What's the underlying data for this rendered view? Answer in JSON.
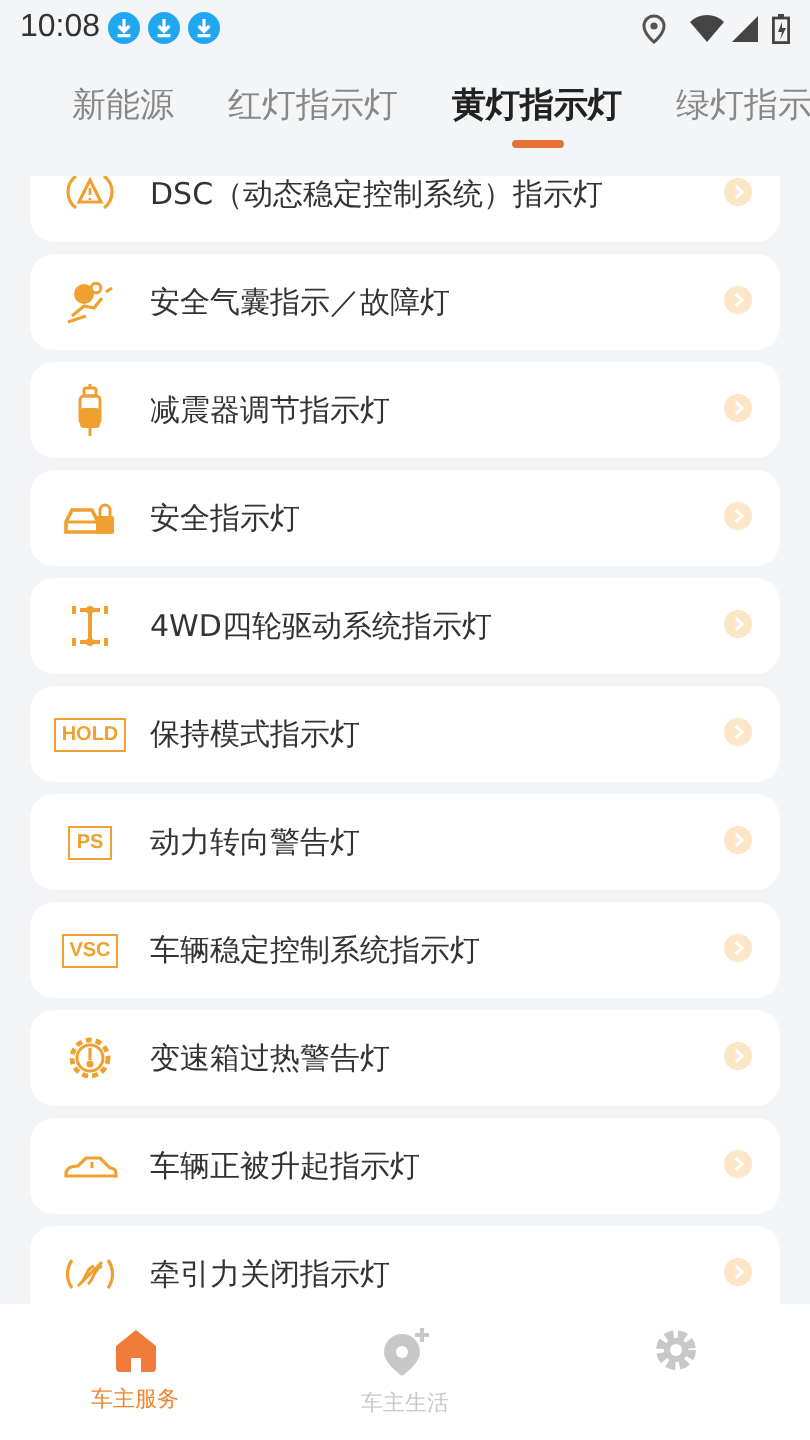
{
  "status_bar": {
    "time": "10:08"
  },
  "tabs": [
    {
      "label": "新能源",
      "selected": false
    },
    {
      "label": "红灯指示灯",
      "selected": false
    },
    {
      "label": "黄灯指示灯",
      "selected": true
    },
    {
      "label": "绿灯指示",
      "selected": false
    }
  ],
  "items": [
    {
      "kind": "symbol",
      "label": "DSC（动态稳定控制系统）指示灯"
    },
    {
      "kind": "symbol",
      "label": "安全气囊指示／故障灯"
    },
    {
      "kind": "symbol",
      "label": "减震器调节指示灯"
    },
    {
      "kind": "symbol",
      "label": "安全指示灯"
    },
    {
      "kind": "symbol",
      "label": "4WD四轮驱动系统指示灯"
    },
    {
      "kind": "badge",
      "badge": "HOLD",
      "label": "保持模式指示灯"
    },
    {
      "kind": "badge",
      "badge": "PS",
      "label": "动力转向警告灯"
    },
    {
      "kind": "badge",
      "badge": "VSC",
      "label": "车辆稳定控制系统指示灯"
    },
    {
      "kind": "symbol",
      "label": "变速箱过热警告灯"
    },
    {
      "kind": "symbol",
      "label": "车辆正被升起指示灯"
    },
    {
      "kind": "symbol",
      "label": "牵引力关闭指示灯"
    }
  ],
  "bottom_nav": [
    {
      "label": "车主服务",
      "selected": true
    },
    {
      "label": "车主生活",
      "selected": false
    },
    {
      "selected": false
    }
  ]
}
